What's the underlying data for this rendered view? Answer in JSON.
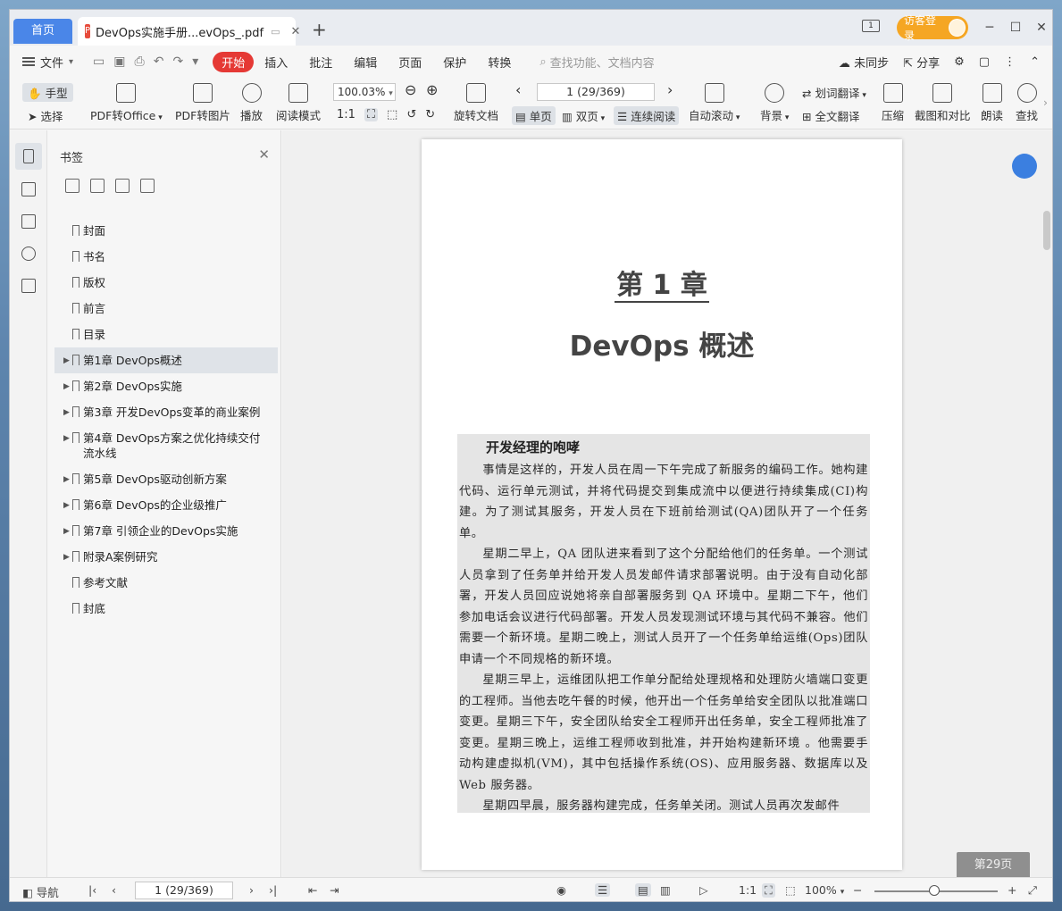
{
  "titlebar": {
    "home_tab": "首页",
    "doc_tab": "DevOps实施手册...evOps_.pdf",
    "new_tab_glyph": "+",
    "visitor_login": "访客登录"
  },
  "menubar": {
    "file": "文件",
    "start": "开始",
    "insert": "插入",
    "annotate": "批注",
    "edit": "编辑",
    "page": "页面",
    "protect": "保护",
    "convert": "转换",
    "search_placeholder": "查找功能、文档内容",
    "unsynced": "未同步",
    "share": "分享"
  },
  "toolbar": {
    "hand": "手型",
    "select": "选择",
    "pdf_to_office": "PDF转Office",
    "pdf_to_image": "PDF转图片",
    "play": "播放",
    "read_mode": "阅读模式",
    "zoom": "100.03%",
    "rotate_doc": "旋转文档",
    "page_indicator": "1 (29/369)",
    "single_page": "单页",
    "double_page": "双页",
    "continuous": "连续阅读",
    "auto_scroll": "自动滚动",
    "background": "背景",
    "word_translate": "划词翻译",
    "full_translate": "全文翻译",
    "compress": "压缩",
    "screenshot_compare": "截图和对比",
    "read_aloud": "朗读",
    "find": "查找"
  },
  "bookmarks": {
    "title": "书签",
    "items": [
      {
        "label": "封面",
        "expandable": false
      },
      {
        "label": "书名",
        "expandable": false
      },
      {
        "label": "版权",
        "expandable": false
      },
      {
        "label": "前言",
        "expandable": false
      },
      {
        "label": "目录",
        "expandable": false
      },
      {
        "label": "第1章 DevOps概述",
        "expandable": true
      },
      {
        "label": "第2章 DevOps实施",
        "expandable": true
      },
      {
        "label": "第3章 开发DevOps变革的商业案例",
        "expandable": true
      },
      {
        "label": "第4章 DevOps方案之优化持续交付流水线",
        "expandable": true
      },
      {
        "label": "第5章 DevOps驱动创新方案",
        "expandable": true
      },
      {
        "label": "第6章 DevOps的企业级推广",
        "expandable": true
      },
      {
        "label": "第7章 引领企业的DevOps实施",
        "expandable": true
      },
      {
        "label": "附录A案例研究",
        "expandable": true
      },
      {
        "label": "参考文献",
        "expandable": false
      },
      {
        "label": "封底",
        "expandable": false
      }
    ],
    "selected_index": 5
  },
  "document": {
    "chapter": "第 1 章",
    "chapter_title": "DevOps 概述",
    "box_heading": "开发经理的咆哮",
    "paragraphs": [
      "事情是这样的，开发人员在周一下午完成了新服务的编码工作。她构建代码、运行单元测试，并将代码提交到集成流中以便进行持续集成(CI)构建。为了测试其服务，开发人员在下班前给测试(QA)团队开了一个任务单。",
      "星期二早上，QA 团队进来看到了这个分配给他们的任务单。一个测试人员拿到了任务单并给开发人员发邮件请求部署说明。由于没有自动化部署，开发人员回应说她将亲自部署服务到 QA 环境中。星期二下午，他们参加电话会议进行代码部署。开发人员发现测试环境与其代码不兼容。他们需要一个新环境。星期二晚上，测试人员开了一个任务单给运维(Ops)团队申请一个不同规格的新环境。",
      "星期三早上，运维团队把工作单分配给处理规格和处理防火墙端口变更的工程师。当他去吃午餐的时候，他开出一个任务单给安全团队以批准端口变更。星期三下午，安全团队给安全工程师开出任务单，安全工程师批准了变更。星期三晚上，运维工程师收到批准，并开始构建新环境 。他需要手动构建虚拟机(VM)，其中包括操作系统(OS)、应用服务器、数据库以及 Web 服务器。",
      "星期四早晨，服务器构建完成，任务单关闭。测试人员再次发邮件"
    ],
    "page_badge": "第29页"
  },
  "statusbar": {
    "nav": "导航",
    "page_indicator": "1 (29/369)",
    "zoom": "100%"
  }
}
